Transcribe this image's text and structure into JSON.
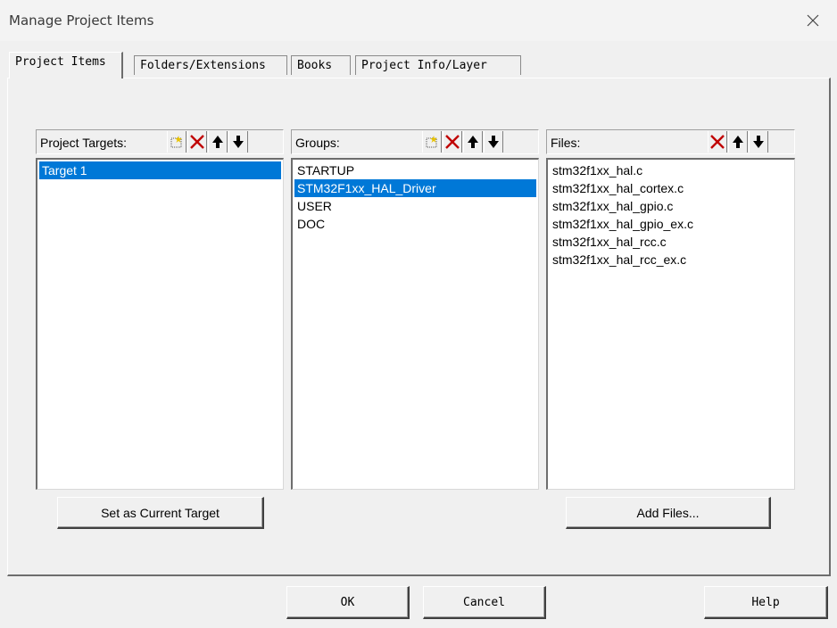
{
  "window": {
    "title": "Manage Project Items"
  },
  "tabs": [
    {
      "label": "Project Items"
    },
    {
      "label": "Folders/Extensions"
    },
    {
      "label": "Books"
    },
    {
      "label": "Project Info/Layer"
    }
  ],
  "targets": {
    "label": "Project Targets:",
    "items": [
      "Target 1"
    ],
    "selected_index": 0,
    "set_current_label": "Set as Current Target"
  },
  "groups": {
    "label": "Groups:",
    "items": [
      "STARTUP",
      "STM32F1xx_HAL_Driver",
      "USER",
      "DOC"
    ],
    "selected_index": 1
  },
  "files": {
    "label": "Files:",
    "items": [
      "stm32f1xx_hal.c",
      "stm32f1xx_hal_cortex.c",
      "stm32f1xx_hal_gpio.c",
      "stm32f1xx_hal_gpio_ex.c",
      "stm32f1xx_hal_rcc.c",
      "stm32f1xx_hal_rcc_ex.c"
    ],
    "add_label": "Add Files..."
  },
  "footer": {
    "ok": "OK",
    "cancel": "Cancel",
    "help": "Help"
  },
  "icons": {
    "new": "new-item-icon",
    "delete": "delete-icon",
    "up": "move-up-icon",
    "down": "move-down-icon"
  },
  "colors": {
    "selection": "#0078d7",
    "delete": "#c00000"
  }
}
